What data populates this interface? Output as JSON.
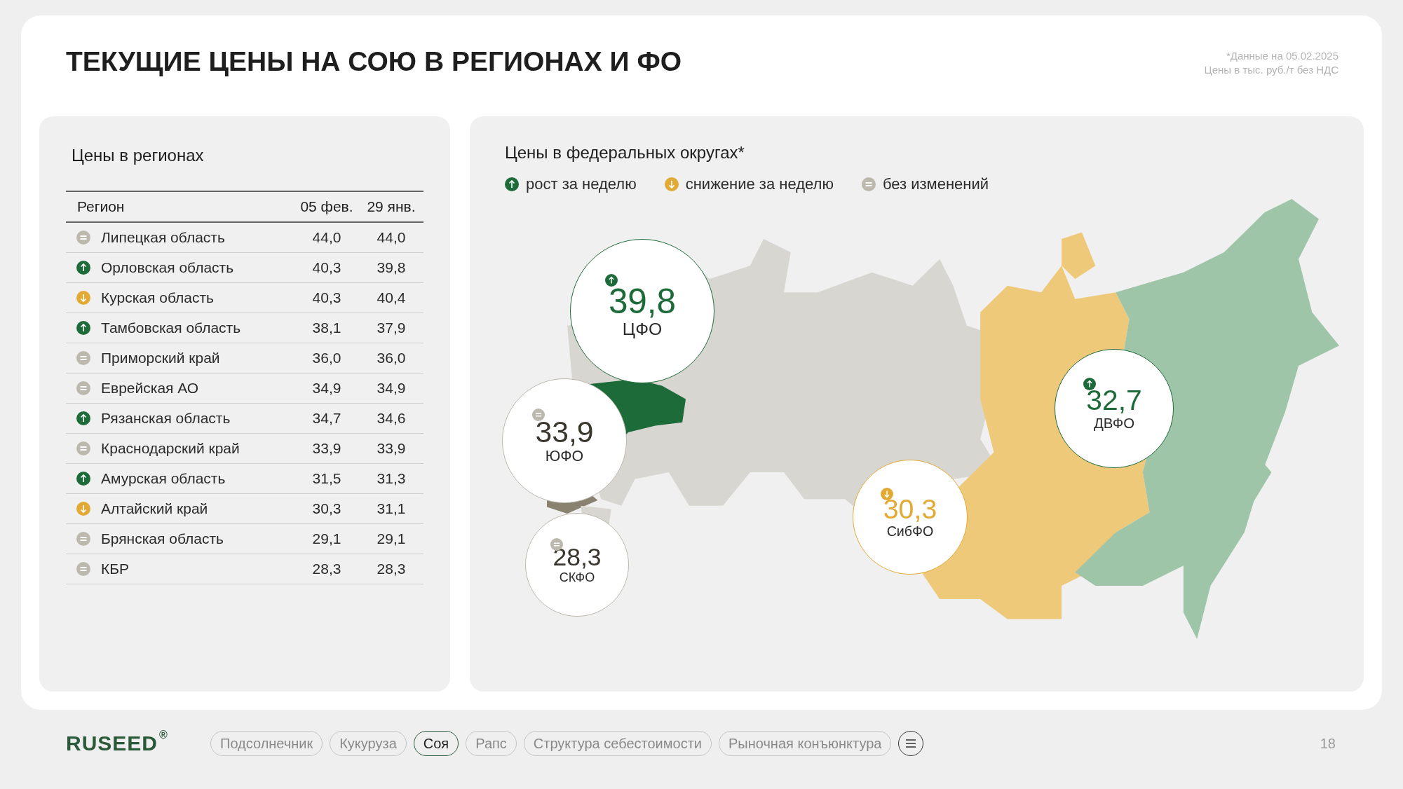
{
  "title": "ТЕКУЩИЕ ЦЕНЫ НА СОЮ В РЕГИОНАХ И ФО",
  "notes": [
    "*Данные на 05.02.2025",
    "Цены в тыс. руб./т без НДС"
  ],
  "regions_panel": {
    "title": "Цены в регионах",
    "columns": [
      "Регион",
      "05 фев.",
      "29 янв."
    ],
    "rows": [
      {
        "kind": "same",
        "region": "Липецкая область",
        "current": "44,0",
        "previous": "44,0"
      },
      {
        "kind": "up",
        "region": "Орловская область",
        "current": "40,3",
        "previous": "39,8"
      },
      {
        "kind": "down",
        "region": "Курская область",
        "current": "40,3",
        "previous": "40,4"
      },
      {
        "kind": "up",
        "region": "Тамбовская область",
        "current": "38,1",
        "previous": "37,9"
      },
      {
        "kind": "same",
        "region": "Приморский край",
        "current": "36,0",
        "previous": "36,0"
      },
      {
        "kind": "same",
        "region": "Еврейская АО",
        "current": "34,9",
        "previous": "34,9"
      },
      {
        "kind": "up",
        "region": "Рязанская область",
        "current": "34,7",
        "previous": "34,6"
      },
      {
        "kind": "same",
        "region": "Краснодарский край",
        "current": "33,9",
        "previous": "33,9"
      },
      {
        "kind": "up",
        "region": "Амурская область",
        "current": "31,5",
        "previous": "31,3"
      },
      {
        "kind": "down",
        "region": "Алтайский край",
        "current": "30,3",
        "previous": "31,1"
      },
      {
        "kind": "same",
        "region": "Брянская область",
        "current": "29,1",
        "previous": "29,1"
      },
      {
        "kind": "same",
        "region": "КБР",
        "current": "28,3",
        "previous": "28,3"
      }
    ]
  },
  "districts_panel": {
    "title": "Цены в федеральных округах*",
    "legend": [
      {
        "kind": "up",
        "label": "рост за неделю"
      },
      {
        "kind": "down",
        "label": "снижение за неделю"
      },
      {
        "kind": "same",
        "label": "без изменений"
      }
    ],
    "districts": [
      {
        "kind": "up",
        "value": "39,8",
        "name": "ЦФО"
      },
      {
        "kind": "same",
        "value": "33,9",
        "name": "ЮФО"
      },
      {
        "kind": "same",
        "value": "28,3",
        "name": "СКФО"
      },
      {
        "kind": "down",
        "value": "30,3",
        "name": "СибФО"
      },
      {
        "kind": "up",
        "value": "32,7",
        "name": "ДВФО"
      }
    ]
  },
  "footer": {
    "logo": "RUSEED",
    "logo_mark": "®",
    "nav": [
      {
        "label": "Подсолнечник",
        "selected": false
      },
      {
        "label": "Кукуруза",
        "selected": false
      },
      {
        "label": "Соя",
        "selected": true
      },
      {
        "label": "Рапс",
        "selected": false
      },
      {
        "label": "Структура себестоимости",
        "selected": false
      },
      {
        "label": "Рыночная конъюнктура",
        "selected": false
      }
    ],
    "page": "18"
  }
}
